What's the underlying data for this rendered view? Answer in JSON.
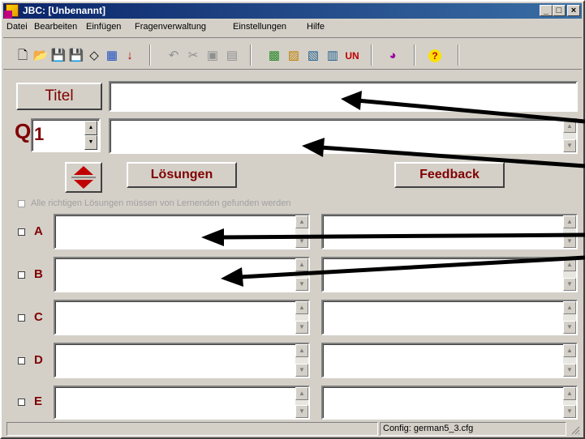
{
  "window": {
    "title": "JBC: [Unbenannt]",
    "controls": [
      "_",
      "□",
      "×"
    ]
  },
  "menu": [
    "Datei",
    "Bearbeiten",
    "Einfügen",
    "Fragenverwaltung",
    "Einstellungen",
    "Hilfe"
  ],
  "toolbar": {
    "icons": [
      "new-file-icon",
      "open-folder-icon",
      "save-icon",
      "save-as-icon",
      "eraser-icon",
      "web-export-icon",
      "red-down-arrow-icon",
      "undo-icon",
      "cut-icon",
      "copy-icon",
      "paste-icon",
      "config-icon-1",
      "config-icon-2",
      "config-icon-3",
      "config-icon-4",
      "unicode-icon",
      "color-palette-icon",
      "help-icon"
    ]
  },
  "form": {
    "title_button": "Titel",
    "title_value": "",
    "q_label": "Q",
    "q_number": "1",
    "question_text": "",
    "loesungen_button": "Lösungen",
    "feedback_button": "Feedback",
    "all_correct_label": "Alle richtigen Lösungen müssen von Lernenden gefunden werden",
    "answers": [
      {
        "letter": "A",
        "text": "",
        "feedback": ""
      },
      {
        "letter": "B",
        "text": "",
        "feedback": ""
      },
      {
        "letter": "C",
        "text": "",
        "feedback": ""
      },
      {
        "letter": "D",
        "text": "",
        "feedback": ""
      },
      {
        "letter": "E",
        "text": "",
        "feedback": ""
      }
    ]
  },
  "statusbar": {
    "left": "",
    "config": "Config: german5_3.cfg"
  },
  "colors": {
    "label_red": "#800000",
    "title_gradient_start": "#0a246a",
    "face": "#d4d0c8"
  }
}
